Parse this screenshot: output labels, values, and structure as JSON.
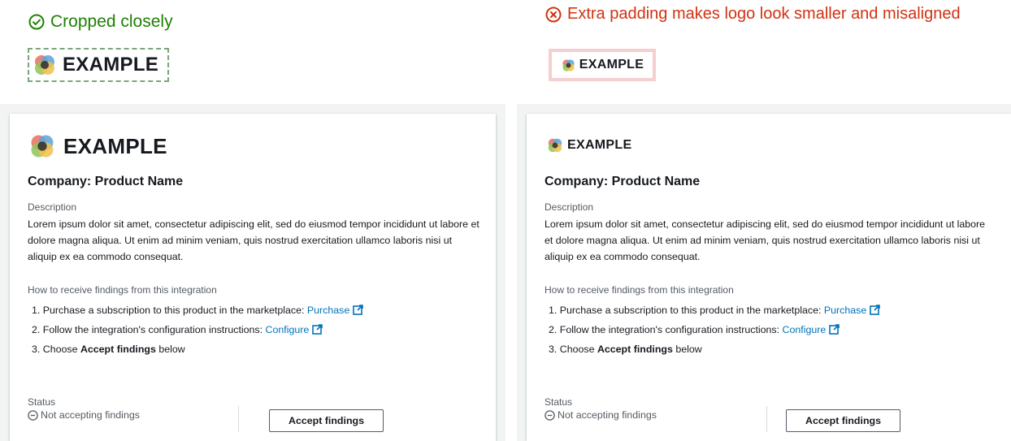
{
  "verdicts": {
    "good": "Cropped closely",
    "bad": "Extra padding makes logo look smaller and misaligned",
    "good_color": "#1d8102",
    "bad_color": "#d13212"
  },
  "logo": {
    "wordmark": "EXAMPLE",
    "icon": "overlapping-circles-logo-icon"
  },
  "card": {
    "product_name": "Company: Product Name",
    "description_label": "Description",
    "description": "Lorem ipsum dolor sit amet, consectetur adipiscing elit, sed do eiusmod tempor incididunt ut labore et dolore magna aliqua. Ut enim ad minim veniam, quis nostrud exercitation ullamco laboris nisi ut aliquip ex ea commodo consequat.",
    "steps_label": "How to receive findings from this integration",
    "steps": [
      {
        "text": "1. Purchase a subscription to this product in the marketplace: ",
        "link": "Purchase"
      },
      {
        "text": "2. Follow the integration's configuration instructions: ",
        "link": "Configure"
      },
      {
        "text": "3. Choose ",
        "bold": "Accept findings",
        "suffix": " below"
      }
    ],
    "status_label": "Status",
    "status_value": "Not accepting findings",
    "accept_button": "Accept findings",
    "link_color": "#0073bb"
  }
}
